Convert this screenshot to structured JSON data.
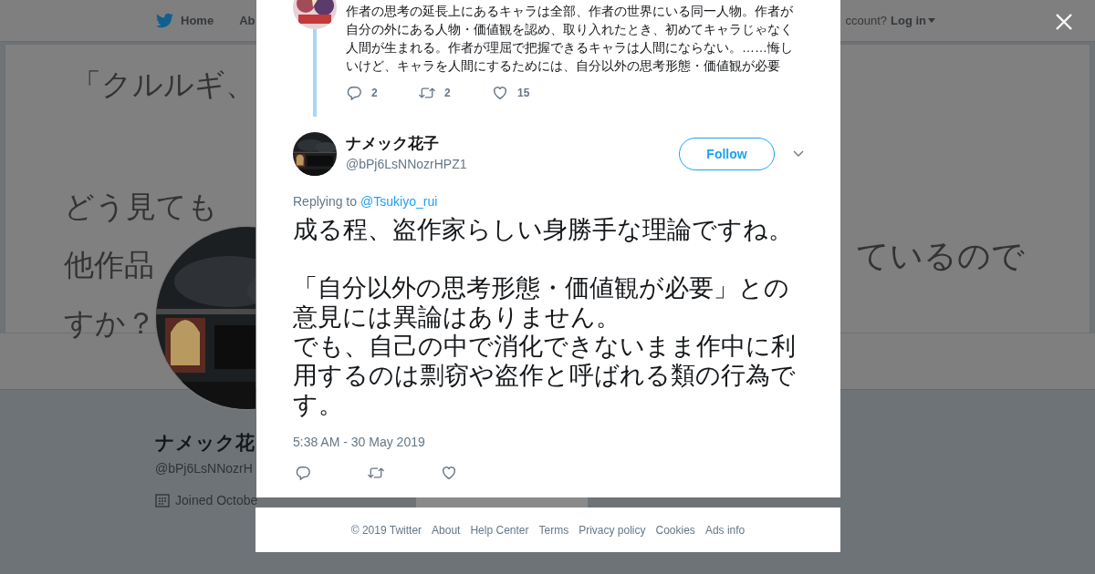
{
  "nav": {
    "items": [
      {
        "label": "Home"
      },
      {
        "label": "Ab"
      }
    ],
    "login_prompt": "ccount?",
    "login": "Log in"
  },
  "header_image": {
    "left_lines": [
      "「クルルギ、",
      "どう見ても",
      "他作品",
      "すか？"
    ],
    "right_text": "ているので"
  },
  "profile": {
    "name": "ナメック花",
    "handle": "@bPj6LsNNozrH",
    "joined": "Joined Octobe"
  },
  "modal": {
    "thread_tweet": {
      "text": "作者の思考の延長上にあるキャラは全部、作者の世界にいる同一人物。作者が自分の外にある人物・価値観を認め、取り入れたとき、初めてキャラじゃなく人間が生まれる。作者が理屈で把握できるキャラは人間にならない。……悔しいけど、キャラを人間にするためには、自分以外の思考形態・価値観が必要",
      "actions": [
        {
          "kind": "reply",
          "count": "2"
        },
        {
          "kind": "retweet",
          "count": "2"
        },
        {
          "kind": "like",
          "count": "15"
        }
      ]
    },
    "tweet": {
      "name": "ナメック花子",
      "handle": "@bPj6LsNNozrHPZ1",
      "follow": "Follow",
      "replying_prefix": "Replying to",
      "replying_to": "@Tsukiyo_rui",
      "paragraphs": [
        [
          "成る程、盗作家らしい身勝手な理論ですね。"
        ],
        [
          "「自分以外の思考形態・価値観が必要」との意見には異論はありません。",
          "でも、自己の中で消化できないまま作中に利用するのは剽窃や盗作と呼ばれる類の行為です。"
        ]
      ],
      "timestamp": "5:38 AM - 30 May 2019",
      "actions": [
        {
          "kind": "reply"
        },
        {
          "kind": "retweet"
        },
        {
          "kind": "like"
        }
      ]
    }
  },
  "footer": {
    "copyright": "© 2019 Twitter",
    "links": [
      "About",
      "Help Center",
      "Terms",
      "Privacy policy",
      "Cookies",
      "Ads info"
    ]
  }
}
